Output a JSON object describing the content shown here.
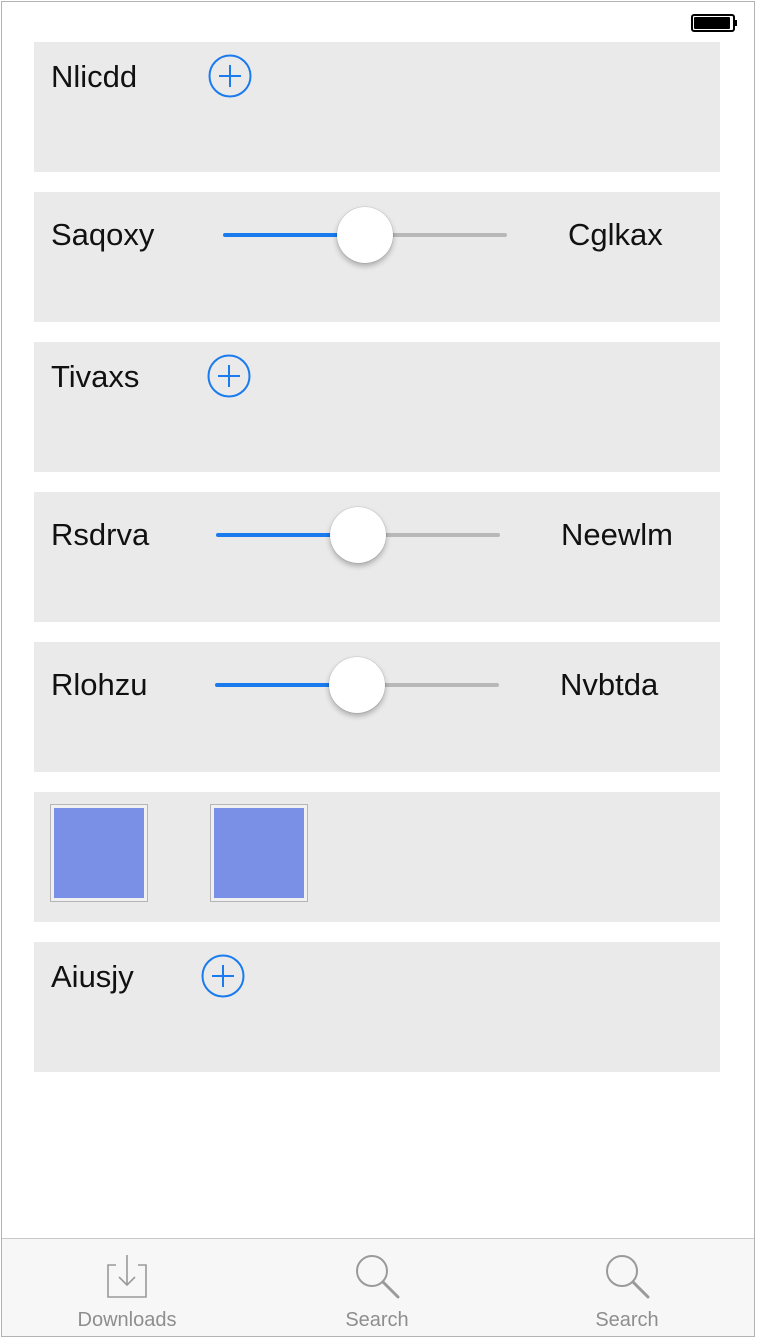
{
  "status_bar": {
    "battery_icon": "battery-full-icon"
  },
  "rows": [
    {
      "type": "add",
      "label": "Nlicdd",
      "icon": "plus-circle-icon"
    },
    {
      "type": "slider",
      "label_left": "Saqoxy",
      "label_right": "Cglkax",
      "value": 0.5
    },
    {
      "type": "add",
      "label": "Tivaxs",
      "icon": "plus-circle-icon"
    },
    {
      "type": "slider",
      "label_left": "Rsdrva",
      "label_right": "Neewlm",
      "value": 0.5
    },
    {
      "type": "slider",
      "label_left": "Rlohzu",
      "label_right": "Nvbtda",
      "value": 0.5
    },
    {
      "type": "swatches",
      "colors": [
        "#7a8fe6",
        "#7a8fe6"
      ]
    },
    {
      "type": "add",
      "label": "Aiusjy",
      "icon": "plus-circle-icon"
    }
  ],
  "tabbar": {
    "tabs": [
      {
        "label": "Downloads",
        "icon": "download-tray-icon"
      },
      {
        "label": "Search",
        "icon": "magnifier-icon"
      },
      {
        "label": "Search",
        "icon": "magnifier-icon"
      }
    ]
  },
  "colors": {
    "accent": "#1a7bef",
    "card_bg": "#eaeaea",
    "tab_label": "#8e8e8e",
    "swatch": "#7a8fe6"
  }
}
